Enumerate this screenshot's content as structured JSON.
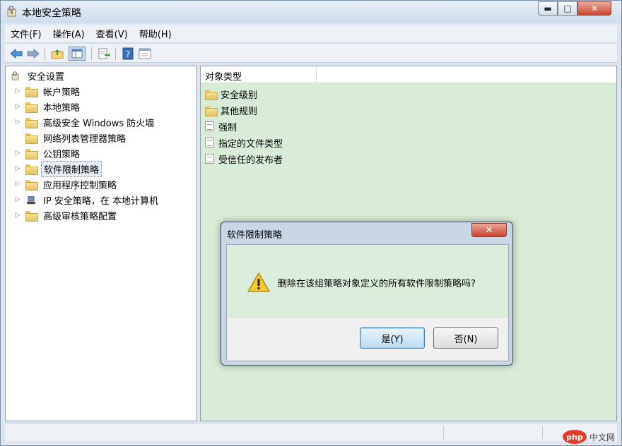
{
  "window": {
    "title": "本地安全策略"
  },
  "menu": [
    {
      "label": "文件(F)"
    },
    {
      "label": "操作(A)"
    },
    {
      "label": "查看(V)"
    },
    {
      "label": "帮助(H)"
    }
  ],
  "toolbar": {
    "icons": [
      "back-arrow-icon",
      "forward-arrow-icon",
      "up-folder-icon",
      "show-hide-tree-icon",
      "export-list-icon",
      "help-icon",
      "properties-icon"
    ]
  },
  "tree": {
    "root": "安全设置",
    "items": [
      {
        "label": "帐户策略",
        "expandable": true
      },
      {
        "label": "本地策略",
        "expandable": true
      },
      {
        "label": "高级安全 Windows 防火墙",
        "expandable": true
      },
      {
        "label": "网络列表管理器策略",
        "expandable": false
      },
      {
        "label": "公钥策略",
        "expandable": true
      },
      {
        "label": "软件限制策略",
        "expandable": true,
        "selected": true
      },
      {
        "label": "应用程序控制策略",
        "expandable": true
      },
      {
        "label": "IP 安全策略，在 本地计算机",
        "expandable": true
      },
      {
        "label": "高级审核策略配置",
        "expandable": true
      }
    ]
  },
  "list": {
    "column_header": "对象类型",
    "items": [
      {
        "label": "安全级别",
        "icon": "folder-icon"
      },
      {
        "label": "其他规则",
        "icon": "folder-icon"
      },
      {
        "label": "强制",
        "icon": "policy-doc-icon"
      },
      {
        "label": "指定的文件类型",
        "icon": "policy-doc-icon"
      },
      {
        "label": "受信任的发布者",
        "icon": "policy-doc-icon"
      }
    ]
  },
  "dialog": {
    "title": "软件限制策略",
    "message": "删除在该组策略对象定义的所有软件限制策略吗?",
    "yes_label": "是(Y)",
    "no_label": "否(N)"
  },
  "watermark": {
    "logo": "php",
    "text": "中文网"
  },
  "colors": {
    "list_background": "#d8ecd7",
    "dialog_close": "#c8432c"
  }
}
